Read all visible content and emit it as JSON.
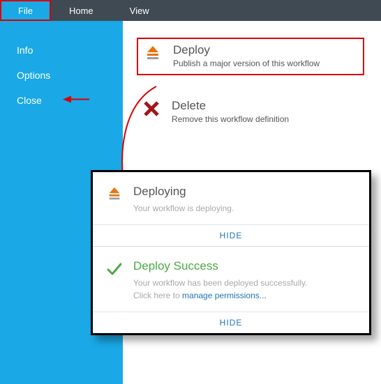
{
  "tabs": {
    "file": "File",
    "home": "Home",
    "view": "View"
  },
  "sidebar": {
    "info": "Info",
    "options": "Options",
    "close": "Close"
  },
  "actions": {
    "deploy": {
      "title": "Deploy",
      "subtitle": "Publish a major version of this workflow"
    },
    "delete": {
      "title": "Delete",
      "subtitle": "Remove this workflow definition"
    }
  },
  "dialog": {
    "deploying": {
      "title": "Deploying",
      "desc": "Your workflow is deploying.",
      "hide": "HIDE"
    },
    "success": {
      "title": "Deploy Success",
      "desc_prefix": "Your workflow has been deployed successfully. Click here to ",
      "link": "manage permissions...",
      "hide": "HIDE"
    }
  }
}
